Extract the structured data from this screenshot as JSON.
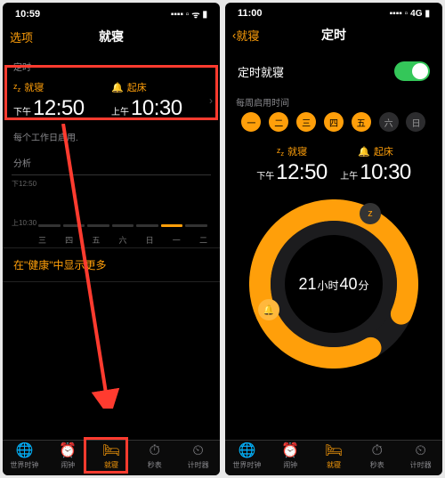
{
  "left": {
    "time": "10:59",
    "signal": "▪▪▪▪ ▫",
    "net": "ᯤ",
    "battery": "▮",
    "options_label": "选项",
    "title": "就寝",
    "sec_timer": "定时",
    "bedtime_label": "就寝",
    "bedtime_prefix": "下午",
    "bedtime_value": "12:50",
    "wake_label": "起床",
    "wake_prefix": "上午",
    "wake_value": "10:30",
    "repeat_note": "每个工作日启用.",
    "analysis_label": "分析",
    "axis_top": "下12:50",
    "axis_bottom": "上10:30",
    "days": [
      "三",
      "四",
      "五",
      "六",
      "日",
      "一",
      "二"
    ],
    "more_link": "在\"健康\"中显示更多"
  },
  "right": {
    "time": "11:00",
    "signal": "▪▪▪▪ ▫",
    "net": "4G",
    "battery": "▮",
    "back_label": "就寝",
    "title": "定时",
    "enable_label": "定时就寝",
    "enable_on": true,
    "week_label": "每周启用时间",
    "days": [
      "一",
      "二",
      "三",
      "四",
      "五",
      "六",
      "日"
    ],
    "days_active": [
      true,
      true,
      true,
      true,
      true,
      false,
      false
    ],
    "bedtime_label": "就寝",
    "bedtime_prefix": "下午",
    "bedtime_value": "12:50",
    "wake_label": "起床",
    "wake_prefix": "上午",
    "wake_value": "10:30",
    "duration_h": "21",
    "duration_h_suffix": "小时",
    "duration_m": "40",
    "duration_m_suffix": "分"
  },
  "tabs": [
    {
      "icon": "🌐",
      "label": "世界时钟"
    },
    {
      "icon": "⏰",
      "label": "闹钟"
    },
    {
      "icon": "🛏",
      "label": "就寝"
    },
    {
      "icon": "⏱",
      "label": "秒表"
    },
    {
      "icon": "⏲",
      "label": "计时器"
    }
  ],
  "colors": {
    "accent": "#ff9f0a",
    "annot": "#ff3b2f",
    "toggle": "#34c759"
  }
}
